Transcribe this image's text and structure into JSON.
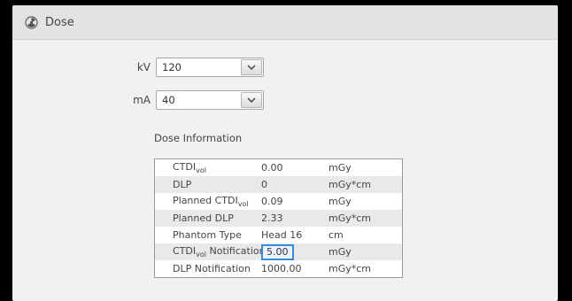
{
  "header": {
    "title": "Dose",
    "icon": "radiation-icon"
  },
  "kv": {
    "label": "kV",
    "value": "120"
  },
  "ma": {
    "label": "mA",
    "value": "40"
  },
  "dose_info": {
    "title": "Dose Information",
    "rows": [
      {
        "name": "CTDI",
        "sub": "vol",
        "value": "0.00",
        "unit": "mGy"
      },
      {
        "name": "DLP",
        "sub": "",
        "value": "0",
        "unit": "mGy*cm"
      },
      {
        "name": "Planned CTDI",
        "sub": "vol",
        "value": "0.09",
        "unit": "mGy"
      },
      {
        "name": "Planned DLP",
        "sub": "",
        "value": "2.33",
        "unit": "mGy*cm"
      },
      {
        "name": "Phantom Type",
        "sub": "",
        "value": "Head 16",
        "unit": "cm"
      },
      {
        "name": "CTDI",
        "sub": "vol",
        "suffix": " Notification",
        "value": "5.00",
        "unit": "mGy",
        "editable": true
      },
      {
        "name": "DLP Notification",
        "sub": "",
        "value": "1000.00",
        "unit": "mGy*cm"
      }
    ]
  },
  "colors": {
    "highlight": "#3d8ad4",
    "panel": "#f1f1f1",
    "titlebar": "#e3e3e3"
  }
}
